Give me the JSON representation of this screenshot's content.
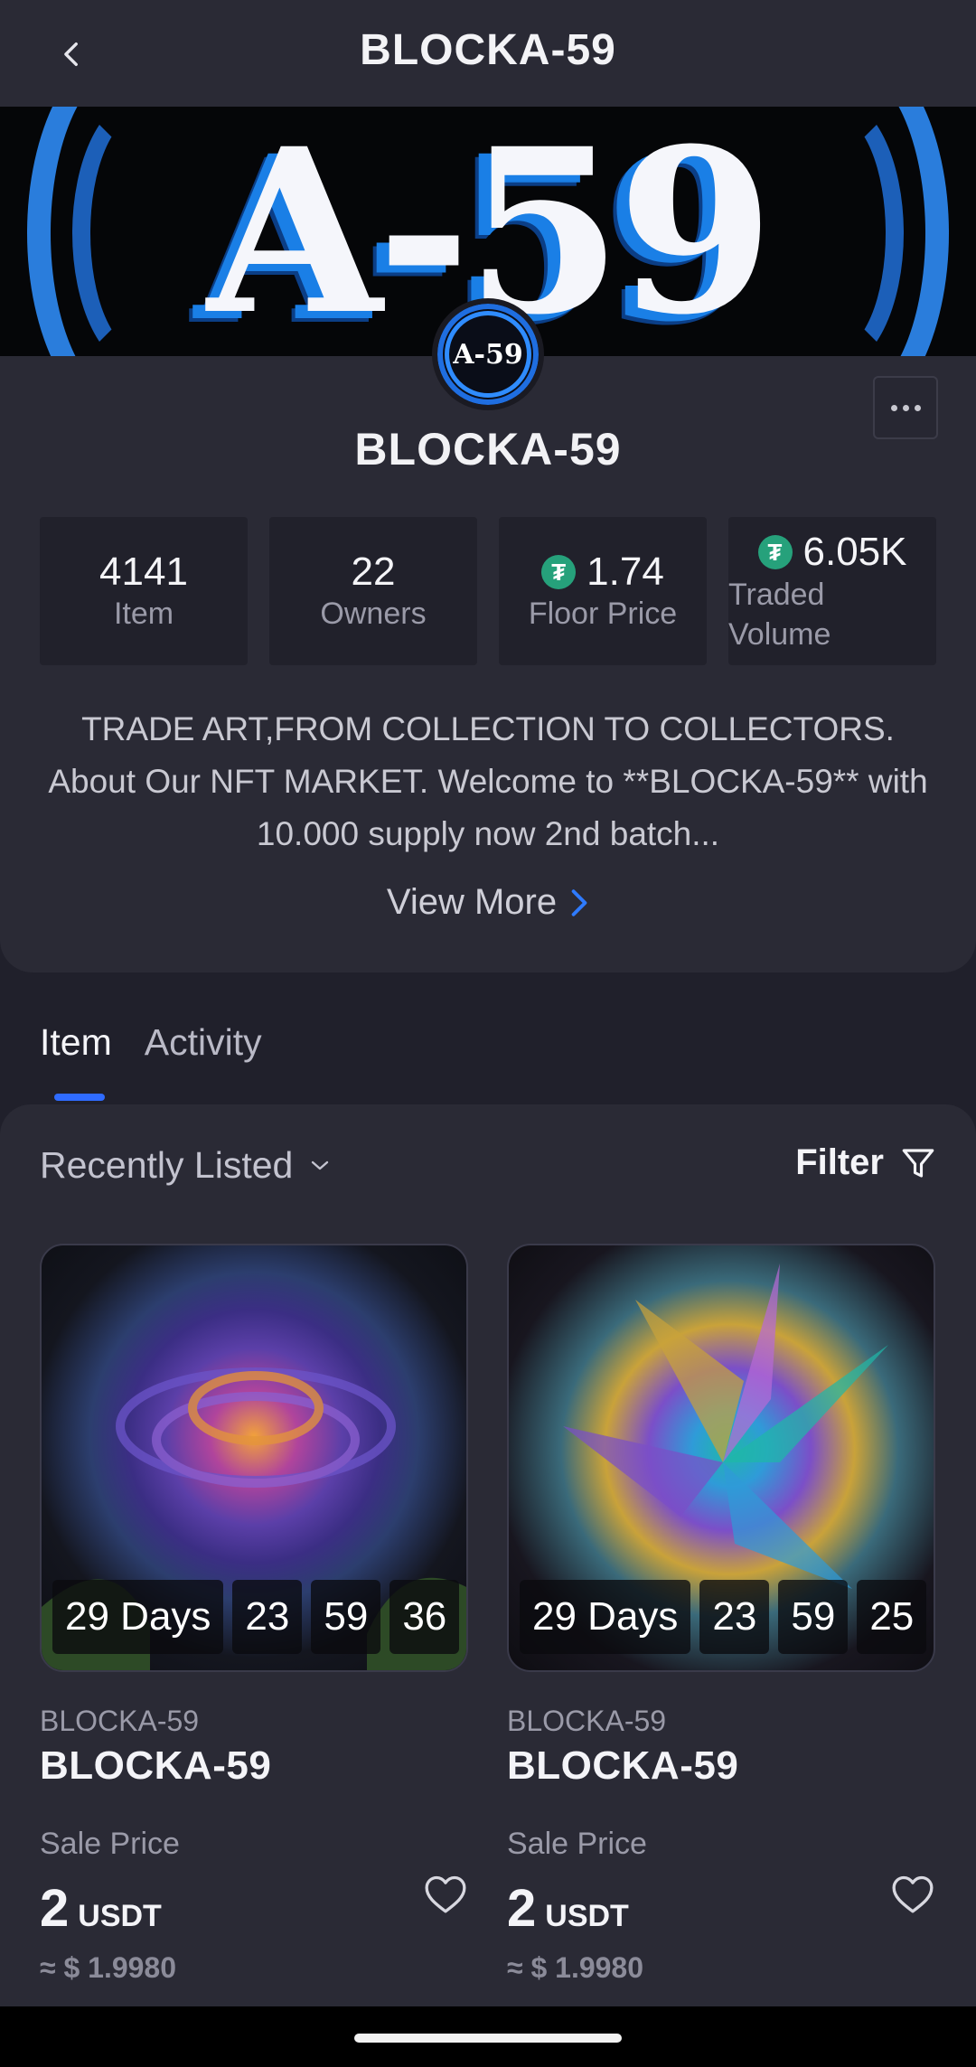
{
  "header": {
    "title": "BLOCKA-59"
  },
  "banner": {
    "text": "A-59"
  },
  "collection": {
    "logo_text": "A-59",
    "name": "BLOCKA-59",
    "stats": {
      "items": {
        "value": "4141",
        "label": "Item"
      },
      "owners": {
        "value": "22",
        "label": "Owners"
      },
      "floor": {
        "value": "1.74",
        "label": "Floor Price"
      },
      "volume": {
        "value": "6.05K",
        "label": "Traded Volume"
      }
    },
    "description": "TRADE ART,FROM COLLECTION TO COLLECTORS. About Our NFT MARKET. Welcome to **BLOCKA-59** with 10.000 supply now 2nd batch...",
    "view_more": "View More"
  },
  "tabs": [
    {
      "label": "Item",
      "active": true
    },
    {
      "label": "Activity",
      "active": false
    }
  ],
  "listing": {
    "sort_label": "Recently Listed",
    "filter_label": "Filter",
    "cards": [
      {
        "collection": "BLOCKA-59",
        "name": "BLOCKA-59",
        "timer": {
          "days": "29 Days",
          "hours": "23",
          "minutes": "59",
          "seconds": "36"
        },
        "sale_label": "Sale Price",
        "price": "2",
        "currency": "USDT",
        "approx": "≈ $ 1.9980"
      },
      {
        "collection": "BLOCKA-59",
        "name": "BLOCKA-59",
        "timer": {
          "days": "29 Days",
          "hours": "23",
          "minutes": "59",
          "seconds": "25"
        },
        "sale_label": "Sale Price",
        "price": "2",
        "currency": "USDT",
        "approx": "≈ $ 1.9980"
      }
    ]
  },
  "colors": {
    "accent": "#2f6bff",
    "tether": "#26a17b",
    "background": "#20202b",
    "surface": "#2a2a35"
  },
  "icons": [
    "back-arrow-icon",
    "more-dots-icon",
    "tether-icon",
    "chevron-right-icon",
    "chevron-down-icon",
    "filter-icon",
    "heart-icon"
  ]
}
